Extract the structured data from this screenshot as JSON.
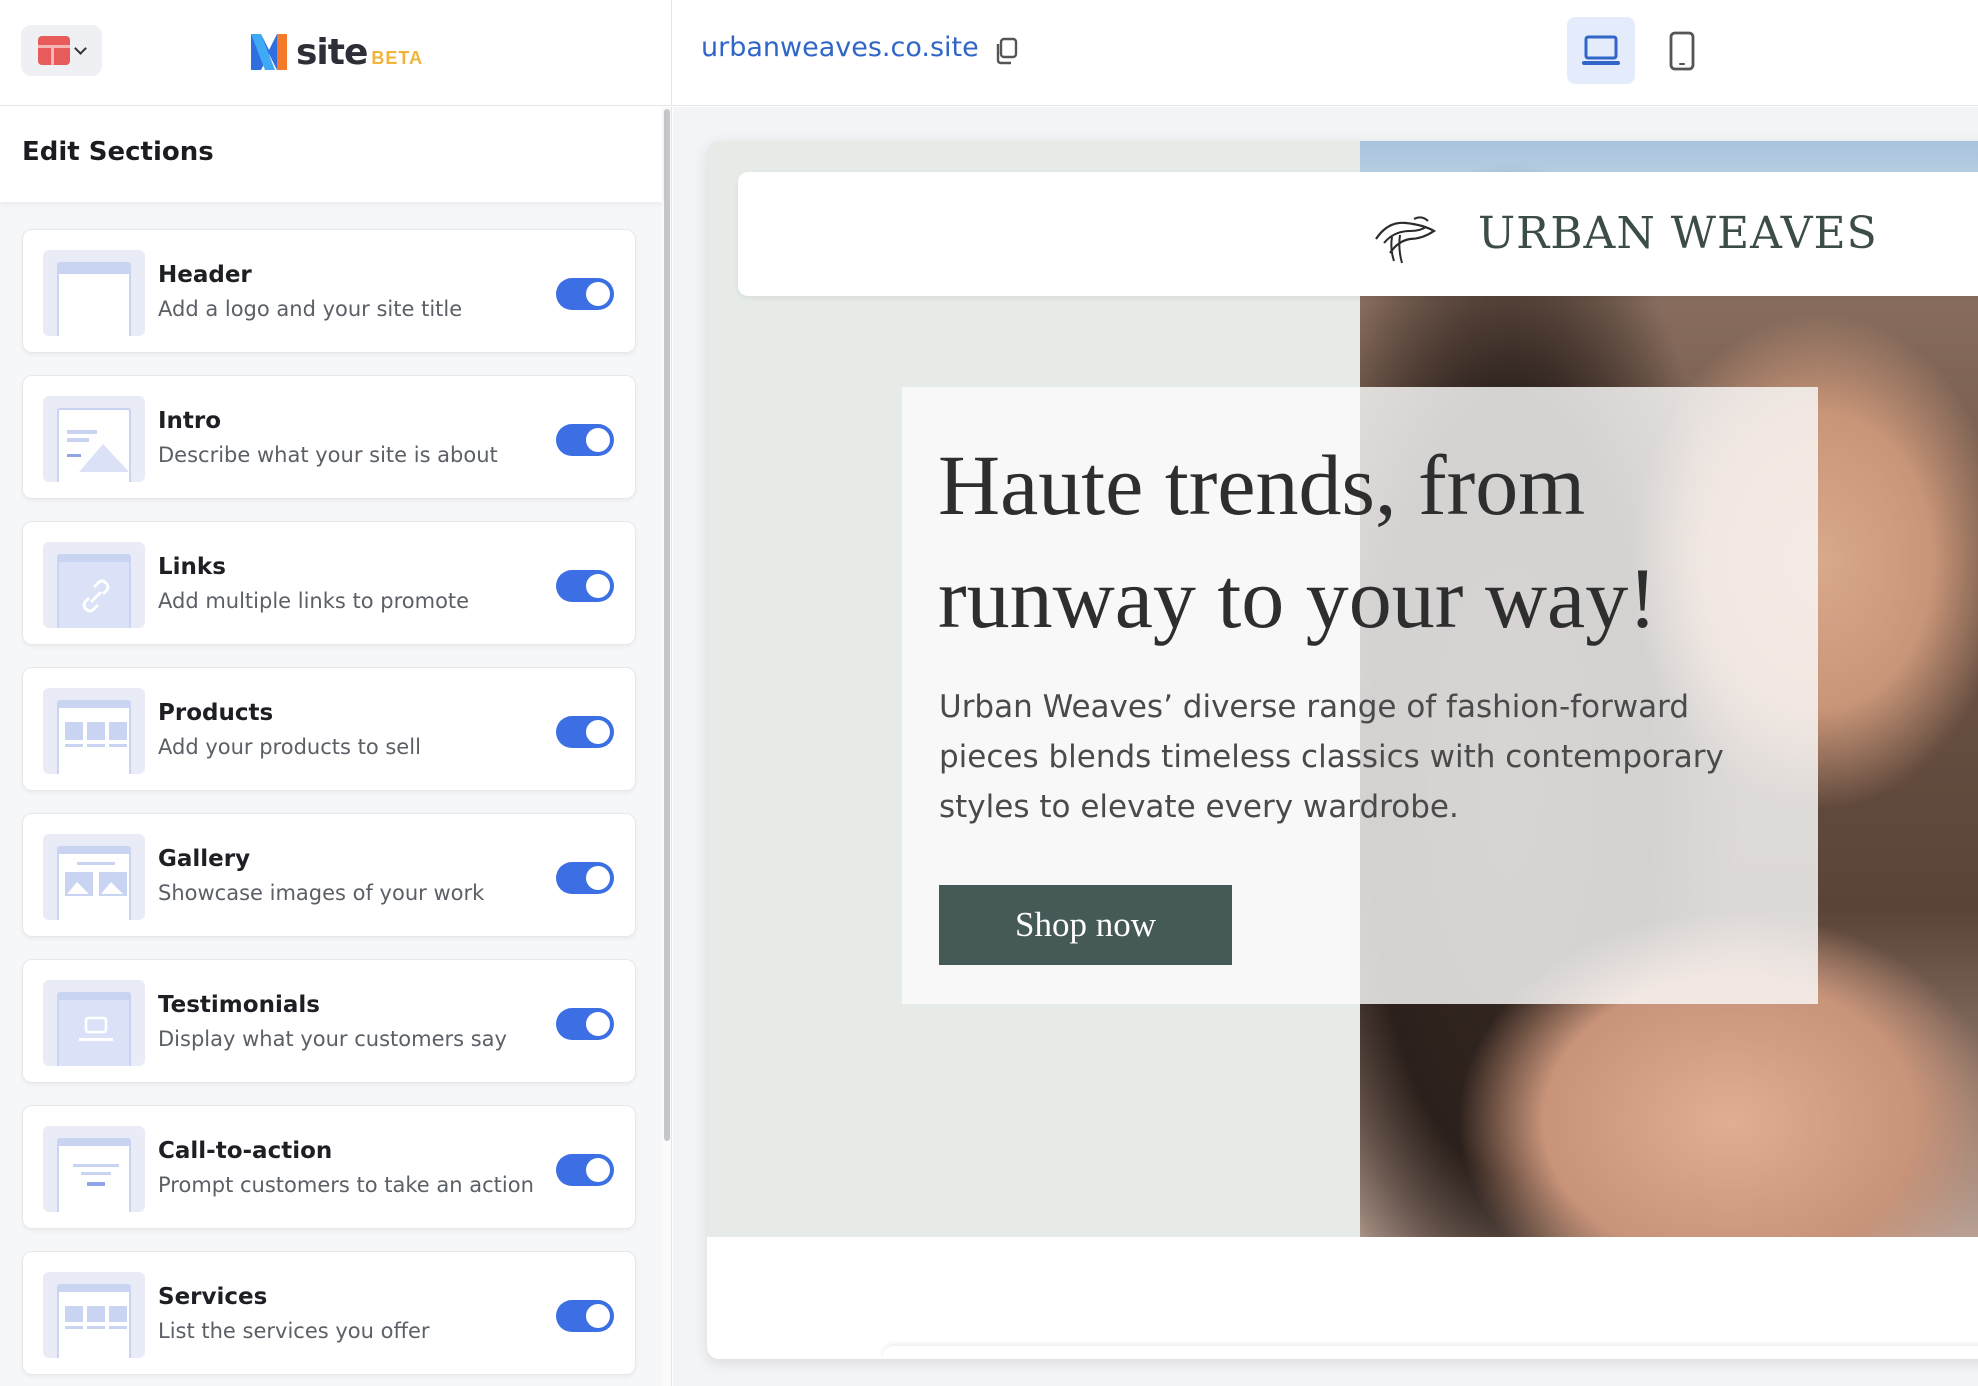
{
  "topbar": {
    "app_switcher_icon": "grid-app-icon",
    "brand_name": "site",
    "brand_badge": "BETA",
    "site_url": "urbanweaves.co.site",
    "copy_icon": "copy-icon",
    "device_desktop_icon": "laptop-icon",
    "device_mobile_icon": "phone-icon",
    "active_device": "desktop",
    "accent_color": "#3b6fe3"
  },
  "sidebar": {
    "title": "Edit Sections",
    "sections": [
      {
        "title": "Header",
        "description": "Add a logo and your site title",
        "enabled": true
      },
      {
        "title": "Intro",
        "description": "Describe what your site is about",
        "enabled": true
      },
      {
        "title": "Links",
        "description": "Add multiple links to promote",
        "enabled": true
      },
      {
        "title": "Products",
        "description": "Add your products to sell",
        "enabled": true
      },
      {
        "title": "Gallery",
        "description": "Showcase images of your work",
        "enabled": true
      },
      {
        "title": "Testimonials",
        "description": "Display what your customers say",
        "enabled": true
      },
      {
        "title": "Call-to-action",
        "description": "Prompt customers to take an action",
        "enabled": true
      },
      {
        "title": "Services",
        "description": "List the services you offer",
        "enabled": true
      }
    ]
  },
  "preview": {
    "site_name": "URBAN WEAVES",
    "hero_title": "Haute trends, from runway to your way!",
    "hero_text": "Urban Weaves’ diverse range of fashion-forward pieces blends timeless classics with contemporary styles to elevate every wardrobe.",
    "cta_label": "Shop now",
    "cta_color": "#455957"
  }
}
